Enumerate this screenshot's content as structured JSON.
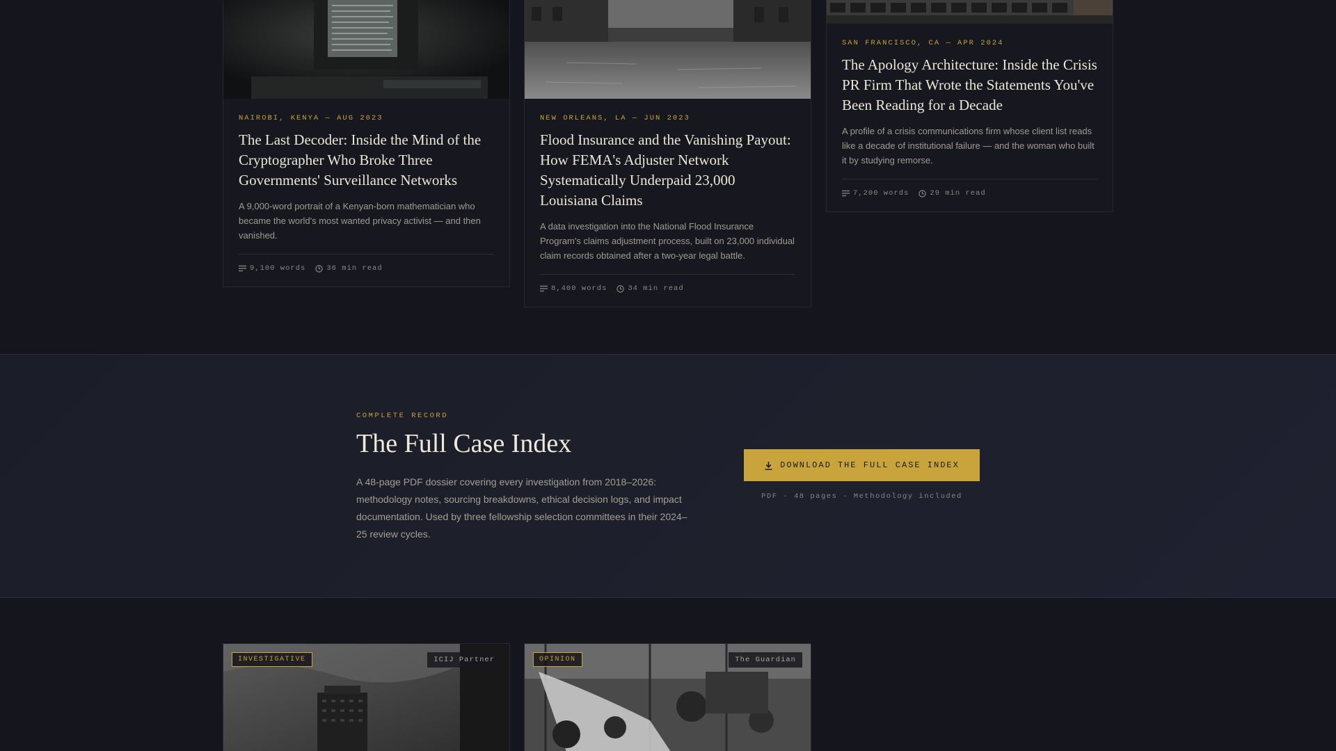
{
  "articles": [
    {
      "dateline": "NAIROBI, KENYA — AUG 2023",
      "title": "The Last Decoder: Inside the Mind of the Cryptographer Who Broke Three Governments' Surveillance Networks",
      "summary": "A 9,000-word portrait of a Kenyan-born mathematician who became the world's most wanted privacy activist — and then vanished.",
      "words": "9,100 words",
      "read_time": "36 min read"
    },
    {
      "dateline": "NEW ORLEANS, LA — JUN 2023",
      "title": "Flood Insurance and the Vanishing Payout: How FEMA's Adjuster Network Systematically Underpaid 23,000 Louisiana Claims",
      "summary": "A data investigation into the National Flood Insurance Program's claims adjustment process, built on 23,000 individual claim records obtained after a two-year legal battle.",
      "words": "8,400 words",
      "read_time": "34 min read"
    },
    {
      "dateline": "SAN FRANCISCO, CA — APR 2024",
      "title": "The Apology Architecture: Inside the Crisis PR Firm That Wrote the Statements You've Been Reading for a Decade",
      "summary": "A profile of a crisis communications firm whose client list reads like a decade of institutional failure — and the woman who built it by studying remorse.",
      "words": "7,200 words",
      "read_time": "29 min read"
    }
  ],
  "cta": {
    "eyebrow": "COMPLETE RECORD",
    "title": "The Full Case Index",
    "description": "A 48-page PDF dossier covering every investigation from 2018–2026: methodology notes, sourcing breakdowns, ethical decision logs, and impact documentation. Used by three fellowship selection committees in their 2024–25 review cycles.",
    "button_label": "DOWNLOAD THE FULL CASE INDEX",
    "note": "PDF · 48 pages · Methodology included"
  },
  "bottom_cards": [
    {
      "tag": "INVESTIGATIVE",
      "source": "ICIJ Partner"
    },
    {
      "tag": "OPINION",
      "source": "The Guardian"
    }
  ],
  "colors": {
    "background": "#15161d",
    "accent": "#c9a23c",
    "card": "#17181f"
  },
  "icons": [
    "words-icon",
    "clock-icon",
    "download-icon"
  ]
}
